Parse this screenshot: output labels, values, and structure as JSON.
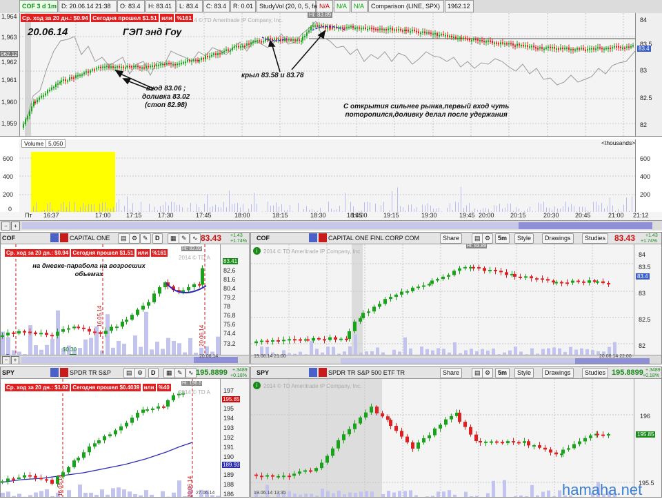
{
  "top": {
    "symbol_label": "COF 3 d 1m",
    "date_field": "D: 20.06.14 21:38",
    "open": "O: 83.4",
    "high": "H: 83.41",
    "low": "L: 83.4",
    "close": "C: 83.4",
    "range": "R: 0.01",
    "studyvol": "StudyVol (20, 0, 5, false, false)",
    "na1": "N/A",
    "na2": "N/A",
    "na3": "N/A",
    "comparison": "Comparison (LINE, SPX)",
    "comp_value": "1962.12",
    "avg_move": "Ср. ход за 20 дн.: $0.94",
    "today_move": "Сегодня прошел $1.51",
    "or_label": "или",
    "pct": "%161",
    "date_title": "20.06.14",
    "gap_title": "ГЭП энд Гоу",
    "copyright": "2014 © TD Ameritrade IP Company, Inc.",
    "hi_tag": "Hi: 83.89",
    "left_price_tag": "962.12",
    "right_price_tag": "83.4",
    "left_axis": [
      "1,964",
      "1,963",
      "1,962",
      "1,961",
      "1,960",
      "1,959"
    ],
    "right_axis": [
      "84",
      "83.5",
      "83",
      "82.5",
      "82"
    ],
    "ann_entry": "вход 83.06 ;\nдоливка 83.02\n(стоп 82.98)",
    "ann_cover": "крыл 83.58 и 83.78",
    "ann_comment": "С открытия сильнее рынка,первый вход чуть\nпоторопился,доливку делал после удержания"
  },
  "volume": {
    "label": "Volume",
    "value": "5,050",
    "unit": "<thousands>",
    "axis": [
      "600",
      "400",
      "200",
      "0"
    ],
    "times": [
      "Пт",
      "16:37",
      "17:00",
      "17:15",
      "17:30",
      "17:45",
      "18:00",
      "18:15",
      "18:30",
      "18:45",
      "19:00",
      "19:15",
      "19:30",
      "19:45",
      "20:00",
      "20:15",
      "20:30",
      "20:45",
      "21:00",
      "21:12"
    ]
  },
  "p1": {
    "symbol": "COF",
    "company": "CAPITAL ONE",
    "btn_d": "D",
    "price": "83.43",
    "chg1": "+1.43",
    "chg2": "+1.74%",
    "avg_move": "Ср. ход за 20 дн.: $0.94",
    "today_move": "Сегодня прошел $1.51",
    "or_label": "или",
    "pct": "%161",
    "hi_tag": "Hi: 83.89",
    "ann": "на дневке-парабола на возросших\nобъемах",
    "axis": [
      "83.41",
      "82.6",
      "81.6",
      "80.4",
      "79.2",
      "78",
      "76.8",
      "75.6",
      "74.4",
      "73.2"
    ],
    "price_tag": "83.41",
    "wm": "2014 © TD A",
    "vert_date1": "16.05.14",
    "vert_date2": "20.06.14",
    "div_label": "$0.30",
    "bottom_date": "20.06.14"
  },
  "p2": {
    "symbol": "COF",
    "company": "CAPITAL ONE FINL CORP COM",
    "share": "Share",
    "interval": "5m",
    "style": "Style",
    "drawings": "Drawings",
    "studies": "Studies",
    "price": "83.43",
    "chg1": "+1.43",
    "chg2": "+1.74%",
    "wm": "2014 © TD Ameritrade IP Company, Inc.",
    "hi_tag": "Hi: 83.89",
    "axis": [
      "84",
      "83.5",
      "83",
      "82.5",
      "82"
    ],
    "price_tag": "83.4",
    "date_left": "19.06.14 21:00",
    "date_right": "20.06.14 22:00"
  },
  "p3": {
    "symbol": "SPY",
    "company": "SPDR TR S&P",
    "btn_d": "D",
    "price": "195.8899",
    "chg1": "+.3489",
    "chg2": "+0.18%",
    "avg_move": "Ср. ход за 20 дн.: $1.02",
    "today_move": "Сегодня прошел $0.4039",
    "or_label": "или",
    "pct": "%40",
    "hi_tag": "Hi: 196.6",
    "wm": "2014 © TD A",
    "axis": [
      "197",
      "196",
      "195",
      "194",
      "193",
      "192",
      "191",
      "190",
      "189",
      "188",
      "187",
      "186"
    ],
    "price_tag1": "195.85",
    "price_tag2": "189.93",
    "vert_date1": "16.05.14",
    "vert_date2": "20.06.14",
    "bottom_date": "27.06.14"
  },
  "p4": {
    "symbol": "SPY",
    "company": "SPDR TR S&P 500 ETF TR",
    "share": "Share",
    "interval": "5m",
    "style": "Style",
    "drawings": "Drawings",
    "studies": "Studies",
    "price": "195.8899",
    "chg1": "+.3489",
    "chg2": "+0.18%",
    "wm": "2014 © TD Ameritrade IP Company, Inc.",
    "axis": [
      "196",
      "195.5"
    ],
    "price_tag": "195.85",
    "date_left": "19.06.14 13:35"
  },
  "watermark": "hamaha.net",
  "colors": {
    "up": "#1aa31a",
    "down": "#e02020",
    "volume_highlight": "#ffff00",
    "volume": "#b9b9f3"
  }
}
